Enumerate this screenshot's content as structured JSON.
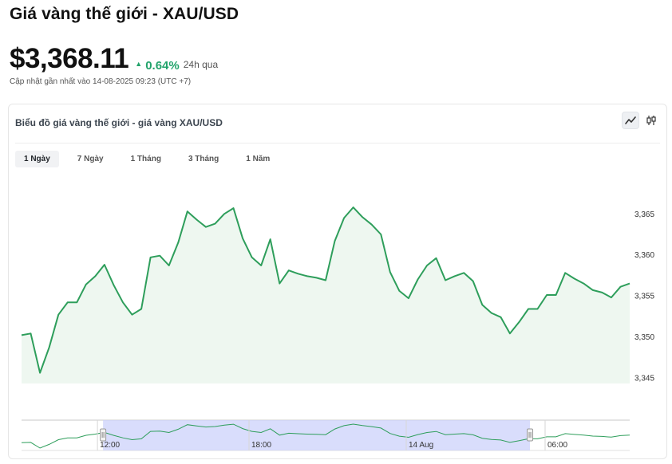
{
  "header": {
    "title": "Giá vàng thế giới - XAU/USD",
    "price": "$3,368.11",
    "change": "0.64%",
    "change_label": "24h qua",
    "updated": "Cập nhật gần nhất vào 14-08-2025 09:23 (UTC +7)"
  },
  "card": {
    "title": "Biểu đồ giá vàng thế giới - giá vàng XAU/USD",
    "tools": [
      "line-chart-icon",
      "candlestick-icon"
    ]
  },
  "tabs": [
    {
      "label": "1 Ngày",
      "active": true
    },
    {
      "label": "7 Ngày",
      "active": false
    },
    {
      "label": "1 Tháng",
      "active": false
    },
    {
      "label": "3 Tháng",
      "active": false
    },
    {
      "label": "1 Năm",
      "active": false
    }
  ],
  "colors": {
    "up": "#22a36b",
    "line": "#2e9e5b",
    "area": "#eef7f0",
    "navigator_window": "#ccd2fb"
  },
  "chart_data": {
    "type": "area",
    "y_ticks": [
      "3,345",
      "3,350",
      "3,355",
      "3,360",
      "3,365"
    ],
    "ylim": [
      3344.3,
      3369.7
    ],
    "grid": false,
    "values": [
      3350.2,
      3350.4,
      3345.6,
      3348.7,
      3352.7,
      3354.2,
      3354.2,
      3356.4,
      3357.4,
      3358.8,
      3356.3,
      3354.2,
      3352.7,
      3353.4,
      3359.7,
      3359.9,
      3358.7,
      3361.5,
      3365.3,
      3364.3,
      3363.4,
      3363.8,
      3365.0,
      3365.7,
      3362.0,
      3359.7,
      3358.7,
      3361.9,
      3356.5,
      3358.1,
      3357.7,
      3357.4,
      3357.2,
      3356.9,
      3361.7,
      3364.5,
      3365.8,
      3364.6,
      3363.7,
      3362.5,
      3357.9,
      3355.6,
      3354.7,
      3357.0,
      3358.7,
      3359.6,
      3356.9,
      3357.4,
      3357.8,
      3356.8,
      3353.9,
      3352.9,
      3352.4,
      3350.4,
      3351.8,
      3353.4,
      3353.4,
      3355.1,
      3355.1,
      3357.8,
      3357.1,
      3356.5,
      3355.7,
      3355.4,
      3354.8,
      3356.1,
      3356.5
    ],
    "navigator": {
      "labels": [
        "12:00",
        "18:00",
        "14 Aug",
        "06:00"
      ],
      "window": [
        0.134,
        0.836
      ]
    }
  }
}
